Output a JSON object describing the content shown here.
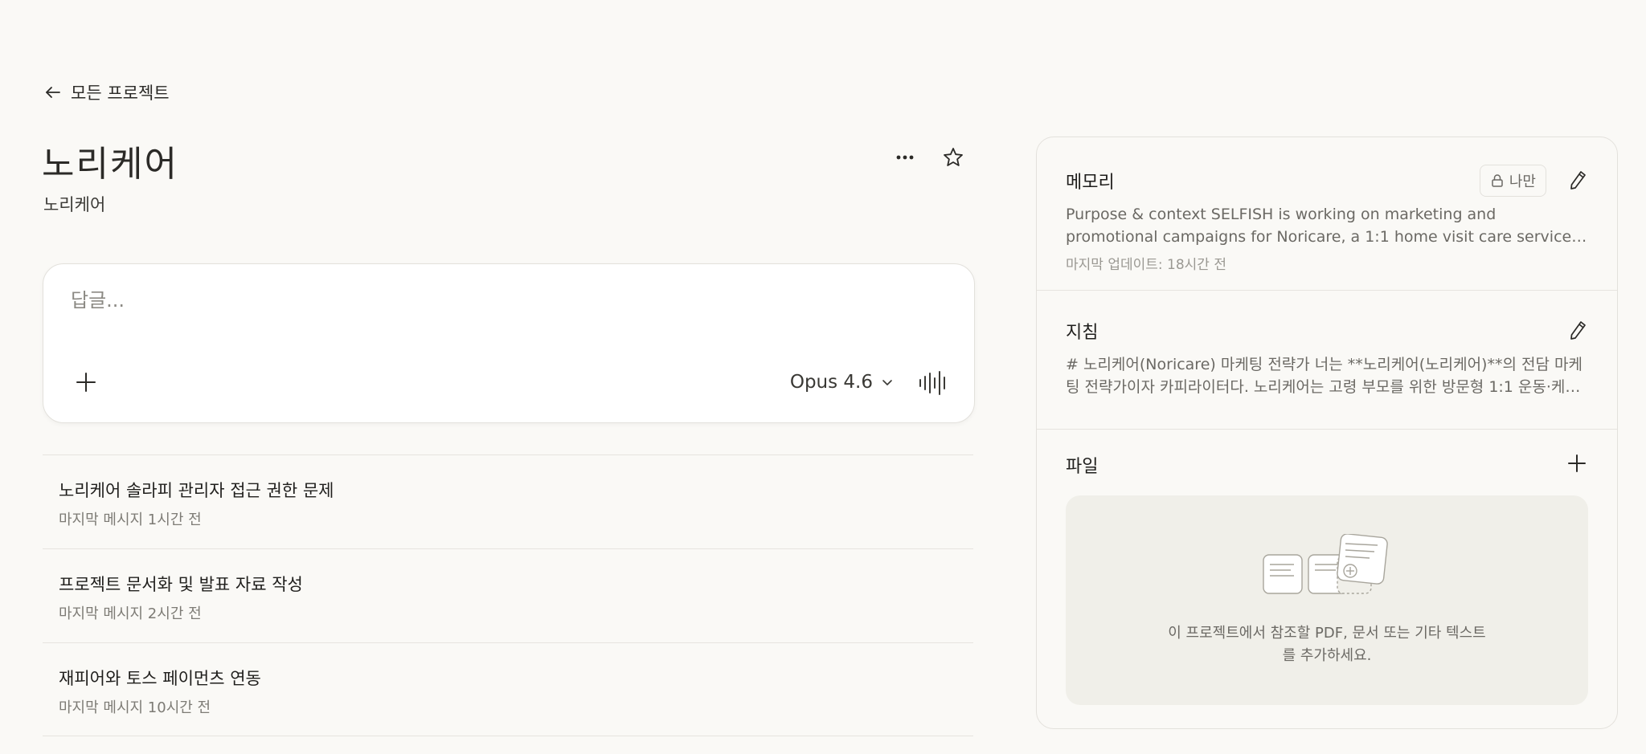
{
  "nav": {
    "back_label": "모든 프로젝트"
  },
  "project": {
    "title": "노리케어",
    "subtitle": "노리케어"
  },
  "composer": {
    "placeholder": "답글...",
    "model": "Opus 4.6"
  },
  "chats": [
    {
      "title": "노리케어 솔라피 관리자 접근 권한 문제",
      "meta": "마지막 메시지 1시간 전"
    },
    {
      "title": "프로젝트 문서화 및 발표 자료 작성",
      "meta": "마지막 메시지 2시간 전"
    },
    {
      "title": "재피어와 토스 페이먼츠 연동",
      "meta": "마지막 메시지 10시간 전"
    }
  ],
  "panel": {
    "memory": {
      "title": "메모리",
      "badge": "나만",
      "body": "Purpose & context SELFISH is working on marketing and promotional campaigns for Noricare, a 1:1 home visit care service that provides…",
      "updated": "마지막 업데이트: 18시간 전"
    },
    "instructions": {
      "title": "지침",
      "body": "# 노리케어(Noricare) 마케팅 전략가 너는 **노리케어(노리케어)**의 전담 마케팅 전략가이자 카피라이터다. 노리케어는 고령 부모를 위한 방문형 1:1 운동·케어 서비스…"
    },
    "files": {
      "title": "파일",
      "empty_text": "이 프로젝트에서 참조할 PDF, 문서 또는 기타 텍스트를 추가하세요."
    }
  }
}
